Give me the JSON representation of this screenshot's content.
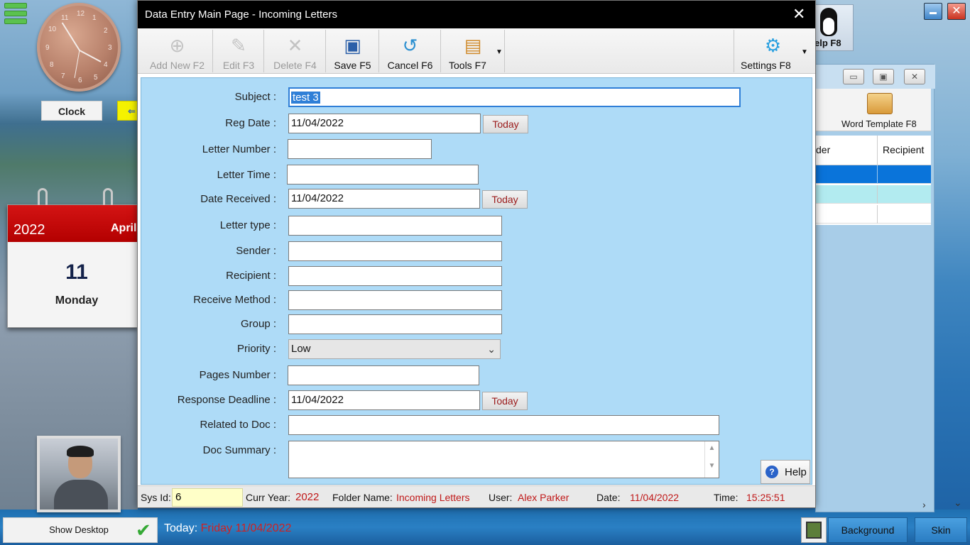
{
  "desktop": {
    "clock_label": "Clock",
    "clock_numbers": [
      "12",
      "1",
      "2",
      "3",
      "4",
      "5",
      "6",
      "7",
      "8",
      "9",
      "10",
      "11"
    ],
    "calendar": {
      "year": "2022",
      "month": "April",
      "day": "11",
      "weekday": "Monday"
    },
    "show_desktop": "Show Desktop",
    "today_label": "Today:",
    "today_value": "Friday 11/04/2022",
    "background_button": "Background",
    "skin_button": "Skin",
    "help_tile_label": "elp F8"
  },
  "bg_window": {
    "toolbar_label": "Word Template F8",
    "col_partial": "der",
    "col_recipient": "Recipient"
  },
  "dialog": {
    "title": "Data Entry Main Page - Incoming Letters",
    "toolbar": [
      {
        "label": "Add New F2",
        "enabled": false,
        "icon": "add-icon"
      },
      {
        "label": "Edit F3",
        "enabled": false,
        "icon": "edit-icon"
      },
      {
        "label": "Delete F4",
        "enabled": false,
        "icon": "delete-icon"
      },
      {
        "label": "Save F5",
        "enabled": true,
        "icon": "save-icon"
      },
      {
        "label": "Cancel F6",
        "enabled": true,
        "icon": "cancel-icon"
      },
      {
        "label": "Tools F7",
        "enabled": true,
        "icon": "tools-icon"
      },
      {
        "label": "Settings F8",
        "enabled": true,
        "icon": "gear-icon"
      }
    ],
    "form": {
      "subject_label": "Subject :",
      "subject_value": "test 3",
      "reg_date_label": "Reg Date :",
      "reg_date_value": "11/04/2022",
      "letter_number_label": "Letter Number :",
      "letter_time_label": "Letter Time :",
      "date_received_label": "Date Received :",
      "date_received_value": "11/04/2022",
      "letter_type_label": "Letter type :",
      "sender_label": "Sender :",
      "recipient_label": "Recipient :",
      "receive_method_label": "Receive Method :",
      "group_label": "Group :",
      "priority_label": "Priority :",
      "priority_value": "Low",
      "pages_number_label": "Pages Number :",
      "response_deadline_label": "Response Deadline :",
      "response_deadline_value": "11/04/2022",
      "related_doc_label": "Related to Doc :",
      "doc_summary_label": "Doc Summary :",
      "today_button": "Today",
      "help_button": "Help"
    },
    "status": {
      "sysid_label": "Sys Id:",
      "sysid_value": "6",
      "curr_year_label": "Curr Year:",
      "curr_year_value": "2022",
      "folder_label": "Folder Name:",
      "folder_value": "Incoming Letters",
      "user_label": "User:",
      "user_value": "Alex Parker",
      "date_label": "Date:",
      "date_value": "11/04/2022",
      "time_label": "Time:",
      "time_value": "15:25:51"
    }
  },
  "colors": {
    "accent_red": "#c01818",
    "form_bg": "#aedbf7",
    "selection": "#2f7fd7",
    "calendar_red": "#d41414"
  }
}
